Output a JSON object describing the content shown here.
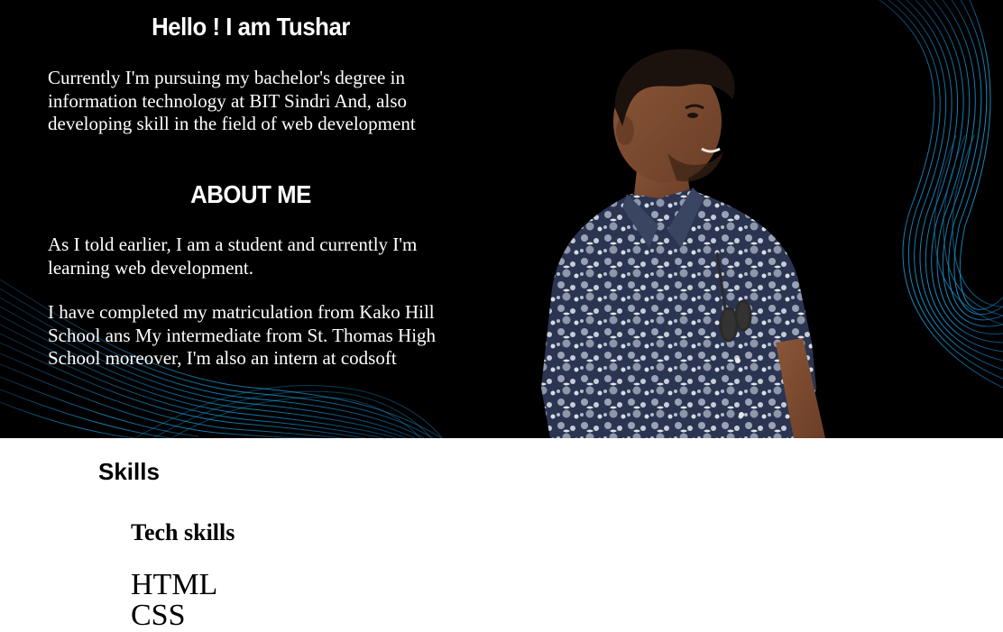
{
  "hero": {
    "greeting": "Hello ! I am Tushar",
    "intro": "Currently I'm pursuing my bachelor's degree in information technology at BIT Sindri And, also developing skill in the field of web development",
    "about_title": "ABOUT ME",
    "about_p1": "As I told earlier, I am a student and currently I'm learning web development.",
    "about_p2": "I have completed my matriculation from Kako Hill School ans My intermediate from St. Thomas High School moreover, I'm also an intern at codsoft",
    "colors": {
      "background": "#000000",
      "wave_accent": "#1ea7e6",
      "text": "#ffffff"
    }
  },
  "skills": {
    "title": "Skills",
    "tech_title": "Tech skills",
    "tech_list": [
      "HTML",
      "CSS"
    ]
  }
}
